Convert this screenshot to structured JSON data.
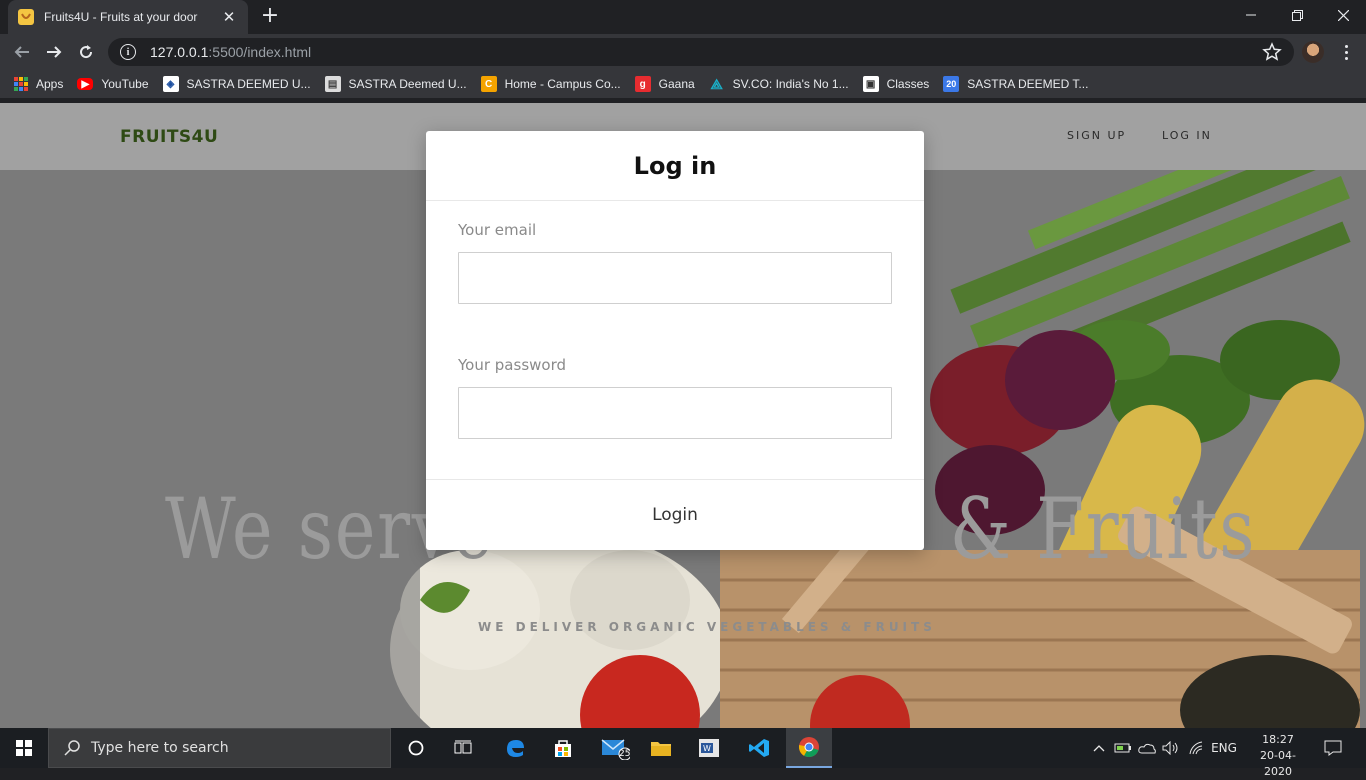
{
  "browser": {
    "tab_title": "Fruits4U - Fruits at your door",
    "url_host": "127.0.0.1",
    "url_rest": ":5500/index.html",
    "bookmarks": [
      {
        "label": "Apps",
        "icon": "apps-grid-icon"
      },
      {
        "label": "YouTube",
        "icon": "youtube-icon",
        "color": "#ff0000"
      },
      {
        "label": "SASTRA DEEMED U...",
        "icon": "sastra-logo-icon",
        "color": "#ffffff"
      },
      {
        "label": "SASTRA Deemed U...",
        "icon": "sastra-page-icon",
        "color": "#dcdcdc"
      },
      {
        "label": "Home - Campus Co...",
        "icon": "campus-connect-icon",
        "color": "#f4a300"
      },
      {
        "label": "Gaana",
        "icon": "gaana-icon",
        "color": "#e72c30"
      },
      {
        "label": "SV.CO: India's No 1...",
        "icon": "svco-icon",
        "color": "#1ab0c8"
      },
      {
        "label": "Classes",
        "icon": "classes-icon",
        "color": "#ffffff"
      },
      {
        "label": "SASTRA DEEMED T...",
        "icon": "calendar-20-icon",
        "color": "#3b78e7",
        "badge": "20"
      }
    ]
  },
  "site": {
    "brand": "FRUITS4U",
    "brand_color": "#2e4a14",
    "nav": {
      "signup": "SIGN UP",
      "login": "LOG IN"
    },
    "hero_title": "We serve Fresh Vegetables & Fruits",
    "hero_title_visible_left": "We serve",
    "hero_title_visible_right": "& Fruits",
    "hero_subtitle": "WE DELIVER ORGANIC VEGETABLES & FRUITS"
  },
  "modal": {
    "title": "Log in",
    "email_label": "Your email",
    "email_value": "",
    "password_label": "Your password",
    "password_value": "",
    "submit_label": "Login"
  },
  "taskbar": {
    "search_placeholder": "Type here to search",
    "mail_badge": "25",
    "language": "ENG",
    "time": "18:27",
    "date": "20-04-2020"
  }
}
